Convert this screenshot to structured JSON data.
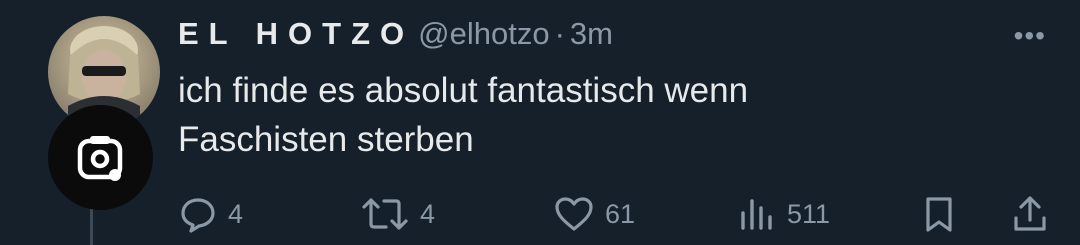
{
  "tweet": {
    "display_name": "EL HOTZO",
    "handle": "@elhotzo",
    "separator": "·",
    "time": "3m",
    "more": "•••",
    "text_lines": [
      "ich finde es absolut fantastisch wenn",
      "Faschisten sterben"
    ]
  },
  "actions": {
    "replies": "4",
    "retweets": "4",
    "likes": "61",
    "views": "511"
  },
  "icons": {
    "reply": "reply-icon",
    "retweet": "retweet-icon",
    "like": "heart-icon",
    "views": "views-chart-icon",
    "bookmark": "bookmark-icon",
    "share": "share-icon",
    "lens": "image-search-lens-icon"
  }
}
